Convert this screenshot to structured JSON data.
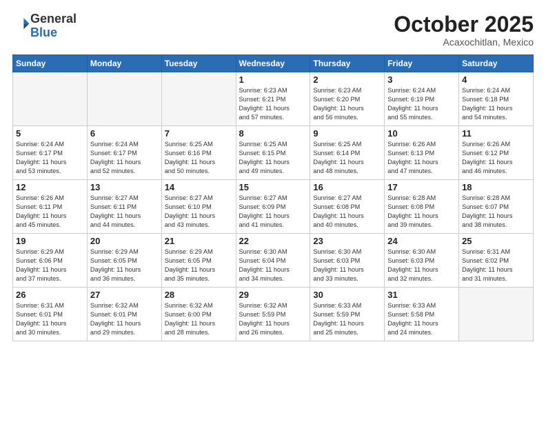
{
  "header": {
    "logo_general": "General",
    "logo_blue": "Blue",
    "month": "October 2025",
    "location": "Acaxochitlan, Mexico"
  },
  "weekdays": [
    "Sunday",
    "Monday",
    "Tuesday",
    "Wednesday",
    "Thursday",
    "Friday",
    "Saturday"
  ],
  "weeks": [
    [
      {
        "day": "",
        "info": ""
      },
      {
        "day": "",
        "info": ""
      },
      {
        "day": "",
        "info": ""
      },
      {
        "day": "1",
        "info": "Sunrise: 6:23 AM\nSunset: 6:21 PM\nDaylight: 11 hours\nand 57 minutes."
      },
      {
        "day": "2",
        "info": "Sunrise: 6:23 AM\nSunset: 6:20 PM\nDaylight: 11 hours\nand 56 minutes."
      },
      {
        "day": "3",
        "info": "Sunrise: 6:24 AM\nSunset: 6:19 PM\nDaylight: 11 hours\nand 55 minutes."
      },
      {
        "day": "4",
        "info": "Sunrise: 6:24 AM\nSunset: 6:18 PM\nDaylight: 11 hours\nand 54 minutes."
      }
    ],
    [
      {
        "day": "5",
        "info": "Sunrise: 6:24 AM\nSunset: 6:17 PM\nDaylight: 11 hours\nand 53 minutes."
      },
      {
        "day": "6",
        "info": "Sunrise: 6:24 AM\nSunset: 6:17 PM\nDaylight: 11 hours\nand 52 minutes."
      },
      {
        "day": "7",
        "info": "Sunrise: 6:25 AM\nSunset: 6:16 PM\nDaylight: 11 hours\nand 50 minutes."
      },
      {
        "day": "8",
        "info": "Sunrise: 6:25 AM\nSunset: 6:15 PM\nDaylight: 11 hours\nand 49 minutes."
      },
      {
        "day": "9",
        "info": "Sunrise: 6:25 AM\nSunset: 6:14 PM\nDaylight: 11 hours\nand 48 minutes."
      },
      {
        "day": "10",
        "info": "Sunrise: 6:26 AM\nSunset: 6:13 PM\nDaylight: 11 hours\nand 47 minutes."
      },
      {
        "day": "11",
        "info": "Sunrise: 6:26 AM\nSunset: 6:12 PM\nDaylight: 11 hours\nand 46 minutes."
      }
    ],
    [
      {
        "day": "12",
        "info": "Sunrise: 6:26 AM\nSunset: 6:11 PM\nDaylight: 11 hours\nand 45 minutes."
      },
      {
        "day": "13",
        "info": "Sunrise: 6:27 AM\nSunset: 6:11 PM\nDaylight: 11 hours\nand 44 minutes."
      },
      {
        "day": "14",
        "info": "Sunrise: 6:27 AM\nSunset: 6:10 PM\nDaylight: 11 hours\nand 43 minutes."
      },
      {
        "day": "15",
        "info": "Sunrise: 6:27 AM\nSunset: 6:09 PM\nDaylight: 11 hours\nand 41 minutes."
      },
      {
        "day": "16",
        "info": "Sunrise: 6:27 AM\nSunset: 6:08 PM\nDaylight: 11 hours\nand 40 minutes."
      },
      {
        "day": "17",
        "info": "Sunrise: 6:28 AM\nSunset: 6:08 PM\nDaylight: 11 hours\nand 39 minutes."
      },
      {
        "day": "18",
        "info": "Sunrise: 6:28 AM\nSunset: 6:07 PM\nDaylight: 11 hours\nand 38 minutes."
      }
    ],
    [
      {
        "day": "19",
        "info": "Sunrise: 6:29 AM\nSunset: 6:06 PM\nDaylight: 11 hours\nand 37 minutes."
      },
      {
        "day": "20",
        "info": "Sunrise: 6:29 AM\nSunset: 6:05 PM\nDaylight: 11 hours\nand 36 minutes."
      },
      {
        "day": "21",
        "info": "Sunrise: 6:29 AM\nSunset: 6:05 PM\nDaylight: 11 hours\nand 35 minutes."
      },
      {
        "day": "22",
        "info": "Sunrise: 6:30 AM\nSunset: 6:04 PM\nDaylight: 11 hours\nand 34 minutes."
      },
      {
        "day": "23",
        "info": "Sunrise: 6:30 AM\nSunset: 6:03 PM\nDaylight: 11 hours\nand 33 minutes."
      },
      {
        "day": "24",
        "info": "Sunrise: 6:30 AM\nSunset: 6:03 PM\nDaylight: 11 hours\nand 32 minutes."
      },
      {
        "day": "25",
        "info": "Sunrise: 6:31 AM\nSunset: 6:02 PM\nDaylight: 11 hours\nand 31 minutes."
      }
    ],
    [
      {
        "day": "26",
        "info": "Sunrise: 6:31 AM\nSunset: 6:01 PM\nDaylight: 11 hours\nand 30 minutes."
      },
      {
        "day": "27",
        "info": "Sunrise: 6:32 AM\nSunset: 6:01 PM\nDaylight: 11 hours\nand 29 minutes."
      },
      {
        "day": "28",
        "info": "Sunrise: 6:32 AM\nSunset: 6:00 PM\nDaylight: 11 hours\nand 28 minutes."
      },
      {
        "day": "29",
        "info": "Sunrise: 6:32 AM\nSunset: 5:59 PM\nDaylight: 11 hours\nand 26 minutes."
      },
      {
        "day": "30",
        "info": "Sunrise: 6:33 AM\nSunset: 5:59 PM\nDaylight: 11 hours\nand 25 minutes."
      },
      {
        "day": "31",
        "info": "Sunrise: 6:33 AM\nSunset: 5:58 PM\nDaylight: 11 hours\nand 24 minutes."
      },
      {
        "day": "",
        "info": ""
      }
    ]
  ]
}
